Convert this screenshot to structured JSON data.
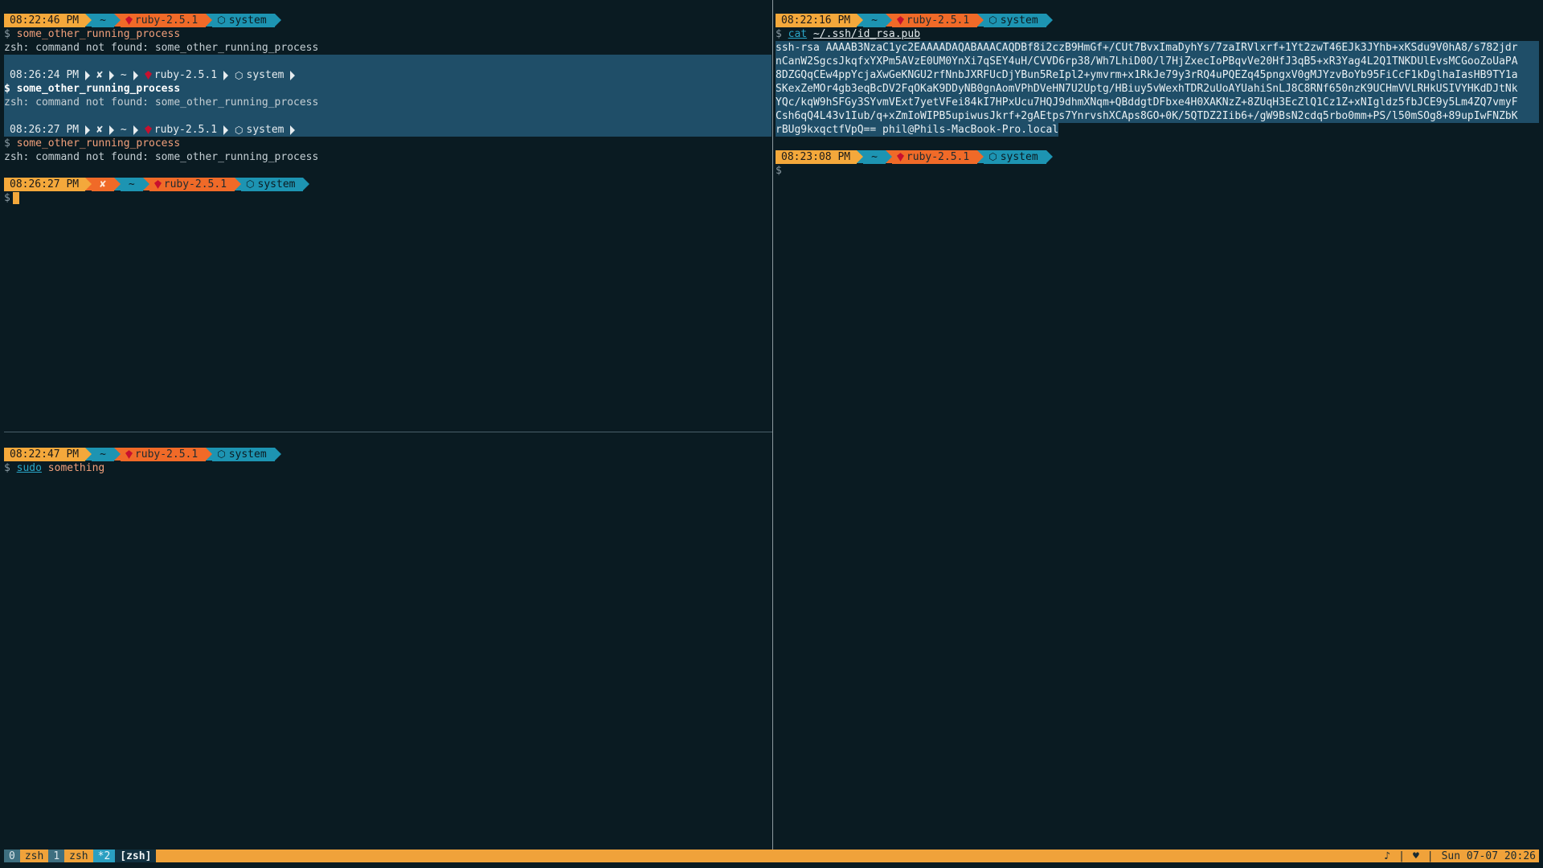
{
  "prompt": {
    "dir": "~",
    "ruby": "ruby-2.5.1",
    "node": "system",
    "error_mark": "✘",
    "dollar": "$"
  },
  "top_left": {
    "p1_time": "08:22:46 PM",
    "cmd1": "some_other_running_process",
    "err1": "zsh: command not found: some_other_running_process",
    "sel_p1_time": "08:26:24 PM",
    "sel_cmd": "some_other_running_process",
    "sel_err": "zsh: command not found: some_other_running_process",
    "sel_p2_time": "08:26:27 PM",
    "cmd3": "some_other_running_process",
    "err3": "zsh: command not found: some_other_running_process",
    "p4_time": "08:26:27 PM"
  },
  "bottom_left": {
    "p_time": "08:22:47 PM",
    "cmd_kw": "sudo",
    "cmd_arg": "something"
  },
  "right": {
    "p1_time": "08:22:16 PM",
    "cmd_kw": "cat",
    "cmd_path": "~/.ssh/id_rsa.pub",
    "key_lines": [
      "ssh-rsa AAAAB3NzaC1yc2EAAAADAQABAAACAQDBf8i2czB9HmGf+/CUt7BvxImaDyhYs/7zaIRVlxrf+1Yt2zwT46EJk3JYhb+xKSdu9V0hA8/s782jdr",
      "nCanW2SgcsJkqfxYXPm5AVzE0UM0YnXi7qSEY4uH/CVVD6rp38/Wh7LhiD0O/l7HjZxecIoPBqvVe20HfJ3qB5+xR3Yag4L2Q1TNKDUlEvsMCGooZoUaPA",
      "8DZGQqCEw4ppYcjaXwGeKNGU2rfNnbJXRFUcDjYBun5ReIpl2+ymvrm+x1RkJe79y3rRQ4uPQEZq45pngxV0gMJYzvBoYb95FiCcF1kDglhaIasHB9TY1a",
      "SKexZeMOr4gb3eqBcDV2FqOKaK9DDyNB0gnAomVPhDVeHN7U2Uptg/HBiuy5vWexhTDR2uUoAYUahiSnLJ8C8RNf650nzK9UCHmVVLRHkUSIVYHKdDJtNk",
      "YQc/kqW9hSFGy3SYvmVExt7yetVFei84kI7HPxUcu7HQJ9dhmXNqm+QBddgtDFbxe4H0XAKNzZ+8ZUqH3EcZlQ1Cz1Z+xNIgldz5fbJCE9y5Lm4ZQ7vmyF",
      "Csh6qQ4L43v1Iub/q+xZmIoWIPB5upiwusJkrf+2gAEtps7YnrvshXCAps8GO+0K/5QTDZ2Iib6+/gW9BsN2cdq5rbo0mm+PS/l50mSOg8+89upIwFNZbK"
    ],
    "key_last": "rBUg9kxqctfVpQ== phil@Phils-MacBook-Pro.local",
    "p2_time": "08:23:08 PM"
  },
  "statusbar": {
    "windows": [
      {
        "index": "0",
        "name": "zsh"
      },
      {
        "index": "1",
        "name": "zsh"
      }
    ],
    "active_index": "*2",
    "active_name": "[zsh]",
    "right_music": "♪",
    "right_sep1": "|",
    "right_heart": "♥",
    "right_sep2": "|",
    "datetime": "Sun 07-07 20:26"
  },
  "colors": {
    "background": "#0a1b22",
    "prompt_time": "#f4a83b",
    "prompt_ruby": "#f06a28",
    "prompt_dir": "#1d94b2",
    "selection": "#1f4e68",
    "statusbar": "#f0a23a"
  }
}
